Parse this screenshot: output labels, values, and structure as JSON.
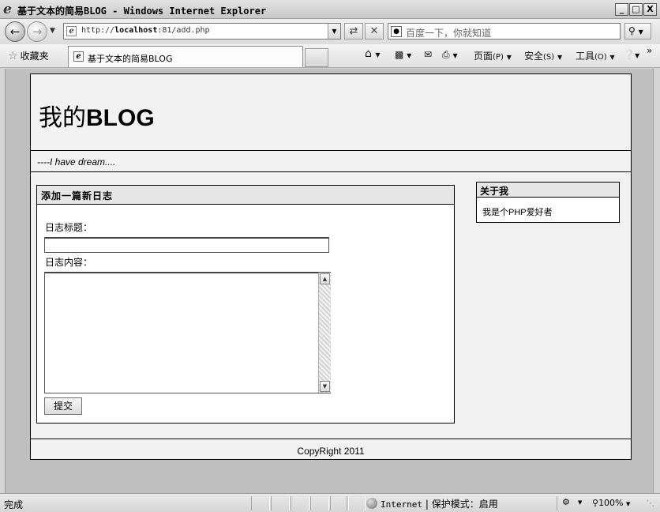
{
  "window": {
    "title": "基于文本的简易BLOG - Windows Internet Explorer",
    "minimize": "_",
    "maximize": "□",
    "close": "X"
  },
  "address_bar": {
    "url_prefix": "http://",
    "url_host": "localhost",
    "url_rest": ":81/add.php"
  },
  "search": {
    "placeholder": "百度一下，你就知道"
  },
  "favorites": {
    "label": "收藏夹",
    "tab_title": "基于文本的简易BLOG"
  },
  "command_bar": {
    "page": "页面",
    "page_key": "(P)",
    "safety": "安全",
    "safety_key": "(S)",
    "tools": "工具",
    "tools_key": "(O)"
  },
  "blog": {
    "title_prefix": "我的",
    "title_bold": "BLOG",
    "tagline": "----I have dream....",
    "post_box_title": "添加一篇新日志",
    "title_label": "日志标题：",
    "title_value": "",
    "content_label": "日志内容：",
    "content_value": "",
    "submit_label": "提交",
    "about_title": "关于我",
    "about_text": "我是个PHP爱好者",
    "footer": "CopyRight 2011"
  },
  "status_bar": {
    "status": "完成",
    "zone": "Internet",
    "separator": "|",
    "protected_mode": "保护模式：启用",
    "zoom": "100%"
  }
}
